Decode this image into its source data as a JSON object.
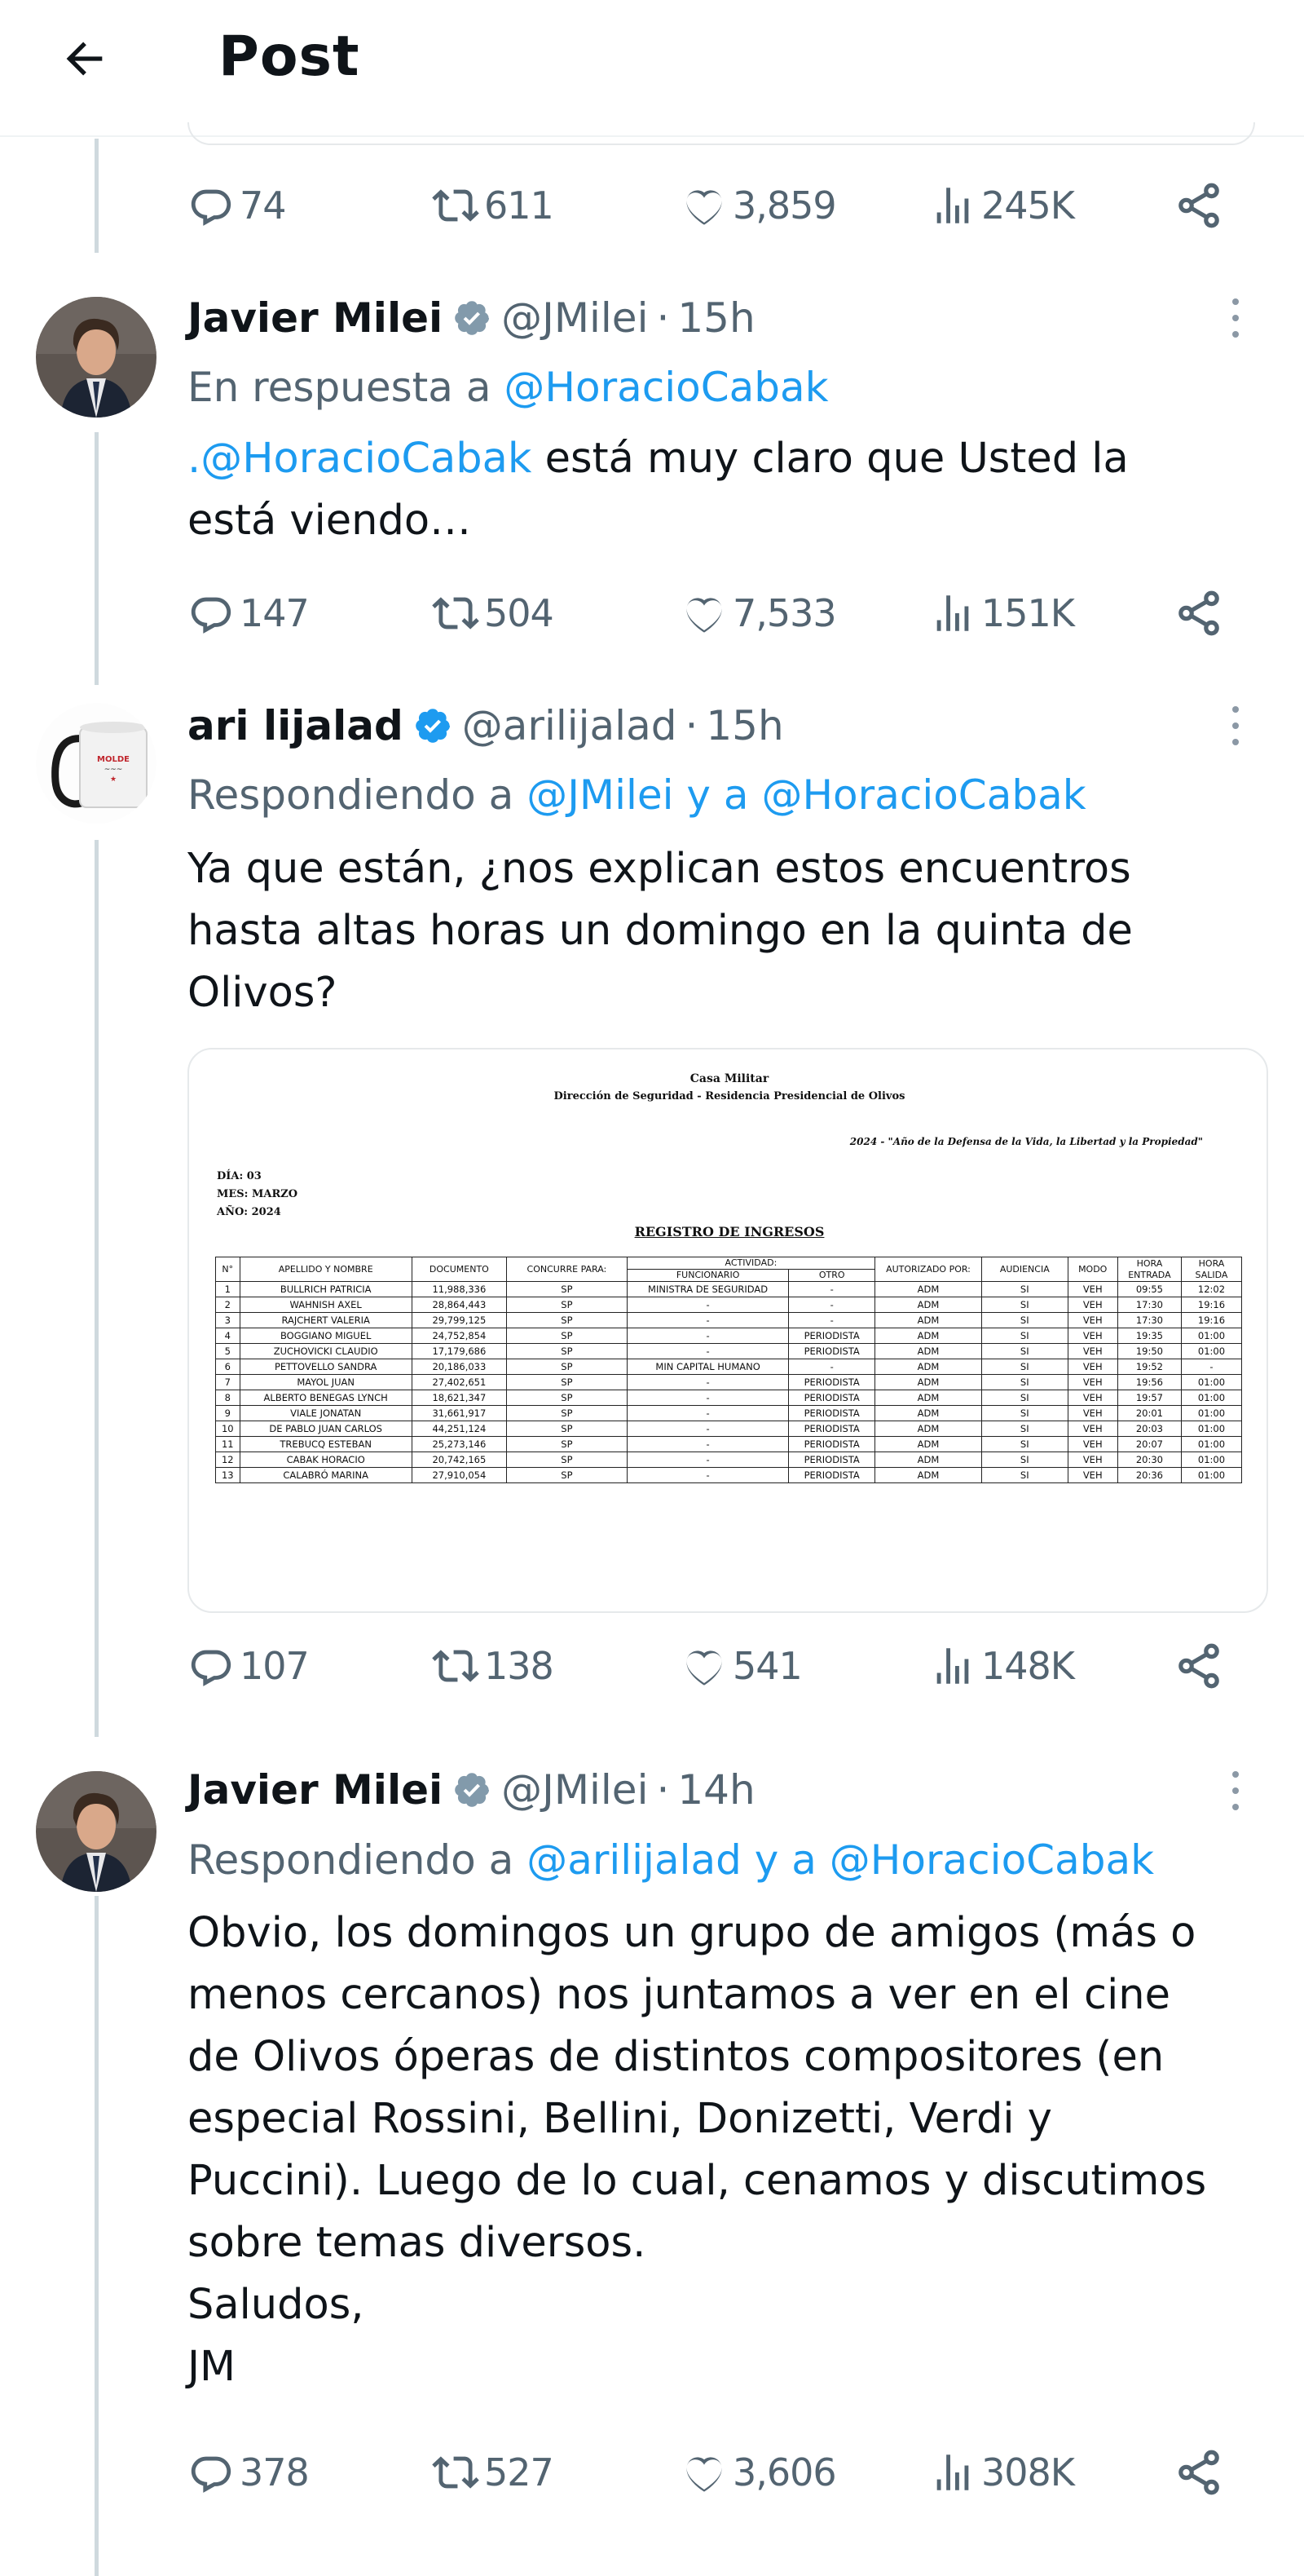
{
  "header": {
    "title": "Post"
  },
  "prev_post": {
    "stats": {
      "replies": "74",
      "reposts": "611",
      "likes": "3,859",
      "views": "245K"
    }
  },
  "tweets": [
    {
      "name": "Javier Milei",
      "handle": "@JMilei",
      "time": "15h",
      "reply_prefix": "En respuesta a",
      "reply_to": [
        "@HoracioCabak"
      ],
      "reply_joiner": "",
      "body_mention": ".@HoracioCabak",
      "body_lines": [
        " está muy claro que Usted la",
        "está viendo…"
      ],
      "stats": {
        "replies": "147",
        "reposts": "504",
        "likes": "7,533",
        "views": "151K"
      }
    },
    {
      "name": "ari lijalad",
      "handle": "@arilijalad",
      "time": "15h",
      "reply_prefix": "Respondiendo a",
      "reply_to": [
        "@JMilei",
        "@HoracioCabak"
      ],
      "reply_joiner": "y a",
      "body_lines": [
        "Ya que están, ¿nos explican estos encuentros",
        "hasta altas horas un domingo en la quinta de",
        "Olivos?"
      ],
      "stats": {
        "replies": "107",
        "reposts": "138",
        "likes": "541",
        "views": "148K"
      },
      "media": {
        "doc_title": "Casa Militar",
        "doc_subtitle": "Dirección de Seguridad - Residencia Presidencial de Olivos",
        "motto": "2024 - \"Año de la Defensa de la Vida, la Libertad y la Propiedad\"",
        "dia": "DÍA: 03",
        "mes": "MES: MARZO",
        "anio": "AÑO: 2024",
        "registro_title": "REGISTRO DE INGRESOS",
        "headers": {
          "n": "N°",
          "apellido": "APELLIDO Y NOMBRE",
          "documento": "DOCUMENTO",
          "concurre": "CONCURRE PARA:",
          "actividad": "ACTIVIDAD:",
          "funcionario": "FUNCIONARIO",
          "otro": "OTRO",
          "autorizado": "AUTORIZADO POR:",
          "audiencia": "AUDIENCIA",
          "modo": "MODO",
          "entrada": "HORA ENTRADA",
          "salida": "HORA SALIDA"
        },
        "rows": [
          [
            "1",
            "BULLRICH PATRICIA",
            "11,988,336",
            "SP",
            "MINISTRA DE SEGURIDAD",
            "-",
            "ADM",
            "SI",
            "VEH",
            "09:55",
            "12:02"
          ],
          [
            "2",
            "WAHNISH AXEL",
            "28,864,443",
            "SP",
            "-",
            "-",
            "ADM",
            "SI",
            "VEH",
            "17:30",
            "19:16"
          ],
          [
            "3",
            "RAJCHERT VALERIA",
            "29,799,125",
            "SP",
            "-",
            "-",
            "ADM",
            "SI",
            "VEH",
            "17:30",
            "19:16"
          ],
          [
            "4",
            "BOGGIANO MIGUEL",
            "24,752,854",
            "SP",
            "-",
            "PERIODISTA",
            "ADM",
            "SI",
            "VEH",
            "19:35",
            "01:00"
          ],
          [
            "5",
            "ZUCHOVICKI CLAUDIO",
            "17,179,686",
            "SP",
            "-",
            "PERIODISTA",
            "ADM",
            "SI",
            "VEH",
            "19:50",
            "01:00"
          ],
          [
            "6",
            "PETTOVELLO SANDRA",
            "20,186,033",
            "SP",
            "MIN CAPITAL HUMANO",
            "-",
            "ADM",
            "SI",
            "VEH",
            "19:52",
            "-"
          ],
          [
            "7",
            "MAYOL JUAN",
            "27,402,651",
            "SP",
            "-",
            "PERIODISTA",
            "ADM",
            "SI",
            "VEH",
            "19:56",
            "01:00"
          ],
          [
            "8",
            "ALBERTO BENEGAS LYNCH",
            "18,621,347",
            "SP",
            "-",
            "PERIODISTA",
            "ADM",
            "SI",
            "VEH",
            "19:57",
            "01:00"
          ],
          [
            "9",
            "VIALE JONATAN",
            "31,661,917",
            "SP",
            "-",
            "PERIODISTA",
            "ADM",
            "SI",
            "VEH",
            "20:01",
            "01:00"
          ],
          [
            "10",
            "DE PABLO JUAN CARLOS",
            "44,251,124",
            "SP",
            "-",
            "PERIODISTA",
            "ADM",
            "SI",
            "VEH",
            "20:03",
            "01:00"
          ],
          [
            "11",
            "TREBUCQ ESTEBAN",
            "25,273,146",
            "SP",
            "-",
            "PERIODISTA",
            "ADM",
            "SI",
            "VEH",
            "20:07",
            "01:00"
          ],
          [
            "12",
            "CABAK HORACIO",
            "20,742,165",
            "SP",
            "-",
            "PERIODISTA",
            "ADM",
            "SI",
            "VEH",
            "20:30",
            "01:00"
          ],
          [
            "13",
            "CALABRÓ MARINA",
            "27,910,054",
            "SP",
            "-",
            "PERIODISTA",
            "ADM",
            "SI",
            "VEH",
            "20:36",
            "01:00"
          ]
        ]
      }
    },
    {
      "name": "Javier Milei",
      "handle": "@JMilei",
      "time": "14h",
      "reply_prefix": "Respondiendo a",
      "reply_to": [
        "@arilijalad",
        "@HoracioCabak"
      ],
      "reply_joiner": "y a",
      "body_lines": [
        "Obvio, los domingos un grupo de amigos (más o",
        "menos cercanos) nos juntamos a ver en el cine",
        "de Olivos óperas de distintos compositores (en",
        "especial Rossini, Bellini, Donizetti, Verdi y",
        "Puccini). Luego de lo cual, cenamos y discutimos",
        "sobre temas diversos.",
        "Saludos,",
        "JM"
      ],
      "stats": {
        "replies": "378",
        "reposts": "527",
        "likes": "3,606",
        "views": "308K"
      }
    }
  ],
  "icons": {
    "back": "arrow-left-icon",
    "reply": "comment-icon",
    "repost": "repost-icon",
    "like": "heart-icon",
    "views": "analytics-icon",
    "share": "share-icon",
    "verified": "verified-badge-icon",
    "more": "more-vertical-icon"
  },
  "colors": {
    "accent": "#1d9bf0",
    "secondary_text": "#536471",
    "thread_line": "#cfd9de"
  }
}
